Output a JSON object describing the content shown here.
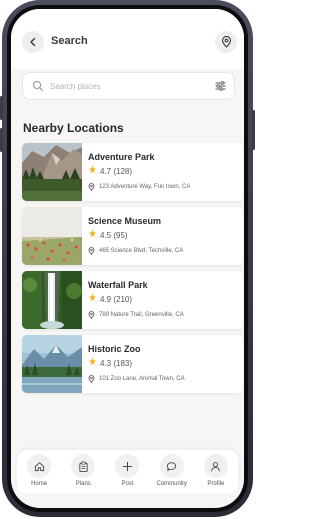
{
  "header": {
    "title": "Search",
    "back_icon": "chevron-left-icon",
    "location_icon": "map-pin-icon"
  },
  "search": {
    "placeholder": "Search places",
    "icon": "search-icon",
    "filter_icon": "sliders-icon"
  },
  "section": {
    "title": "Nearby Locations"
  },
  "locations": [
    {
      "name": "Adventure Park",
      "rating": "4.7",
      "reviews": "(128)",
      "address": "123 Adventure Way, Fun town, CA",
      "rating_value": 4.7,
      "review_count": 128,
      "image": "rocky-mountain-photo"
    },
    {
      "name": "Science Museum",
      "rating": "4.5",
      "reviews": "(95)",
      "address": "465 Science Blvd, Techville, CA",
      "rating_value": 4.5,
      "review_count": 95,
      "image": "flower-field-photo"
    },
    {
      "name": "Waterfall Park",
      "rating": "4.9",
      "reviews": "(210)",
      "address": "789 Nature Trail, Greenville, CA",
      "rating_value": 4.9,
      "review_count": 210,
      "image": "waterfall-photo"
    },
    {
      "name": "Historic Zoo",
      "rating": "4.3",
      "reviews": "(183)",
      "address": "101 Zoo Lane, Animal Town, CA",
      "rating_value": 4.3,
      "review_count": 183,
      "image": "lake-mountain-photo"
    }
  ],
  "nav": [
    {
      "label": "Home",
      "icon": "home-icon"
    },
    {
      "label": "Plans",
      "icon": "clipboard-icon"
    },
    {
      "label": "Post",
      "icon": "plus-icon"
    },
    {
      "label": "Community",
      "icon": "chat-bubble-icon"
    },
    {
      "label": "Profile",
      "icon": "user-icon"
    }
  ],
  "colors": {
    "star": "#f2b01e",
    "screen_bg": "#f6f6f4",
    "frame": "#2a2c36"
  }
}
